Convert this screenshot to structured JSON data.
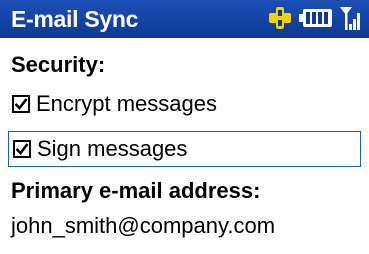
{
  "title_bar": {
    "title": "E-mail Sync",
    "icons": [
      "connectivity-icon",
      "battery-icon",
      "signal-icon"
    ]
  },
  "security": {
    "heading": "Security:",
    "options": [
      {
        "label": "Encrypt messages",
        "checked": true
      },
      {
        "label": "Sign messages",
        "checked": true,
        "focused": true
      }
    ]
  },
  "email": {
    "heading": "Primary e-mail address:",
    "value": "john_smith@company.com"
  },
  "colors": {
    "title_bar": "#1848a8",
    "focus_border": "#1a5fc0"
  }
}
